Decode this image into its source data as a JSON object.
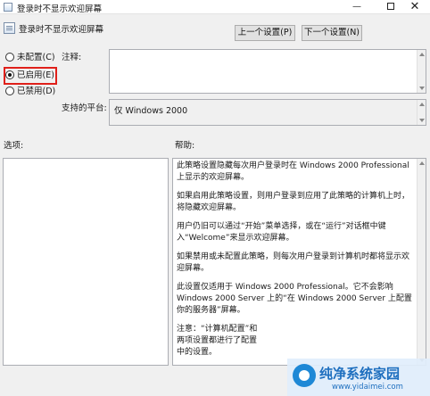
{
  "window": {
    "title": "登录时不显示欢迎屏幕",
    "controls": {
      "minimize": "—",
      "close": "✕"
    }
  },
  "header": {
    "setting_title": "登录时不显示欢迎屏幕",
    "prev_button": "上一个设置(P)",
    "next_button": "下一个设置(N)"
  },
  "radios": [
    {
      "label": "未配置(C)",
      "checked": false
    },
    {
      "label": "已启用(E)",
      "checked": true
    },
    {
      "label": "已禁用(D)",
      "checked": false
    }
  ],
  "comment": {
    "label": "注释:",
    "value": ""
  },
  "platform": {
    "label": "支持的平台:",
    "value": "仅 Windows 2000"
  },
  "options": {
    "label": "选项:"
  },
  "help": {
    "label": "帮助:",
    "paragraphs": [
      "此策略设置隐藏每次用户登录时在 Windows 2000 Professional 上显示的欢迎屏幕。",
      "如果启用此策略设置，则用户登录到应用了此策略的计算机上时，将隐藏欢迎屏幕。",
      "用户仍旧可以通过“开始”菜单选择，或在“运行”对话框中键入“Welcome”来显示欢迎屏幕。",
      "如果禁用或未配置此策略，则每次用户登录到计算机时都将显示欢迎屏幕。",
      "此设置仅适用于 Windows 2000 Professional。它不会影响 Windows 2000 Server 上的“在 Windows 2000 Server 上配置你的服务器”屏幕。",
      "注意：“计算机配置”和",
      "两项设置都进行了配置",
      "中的设置。"
    ]
  },
  "watermark": {
    "title": "纯净系统家园",
    "url": "www.yidaimei.com"
  },
  "colors": {
    "highlight_border": "#e0201a",
    "watermark_blue": "#1e6fbf"
  }
}
